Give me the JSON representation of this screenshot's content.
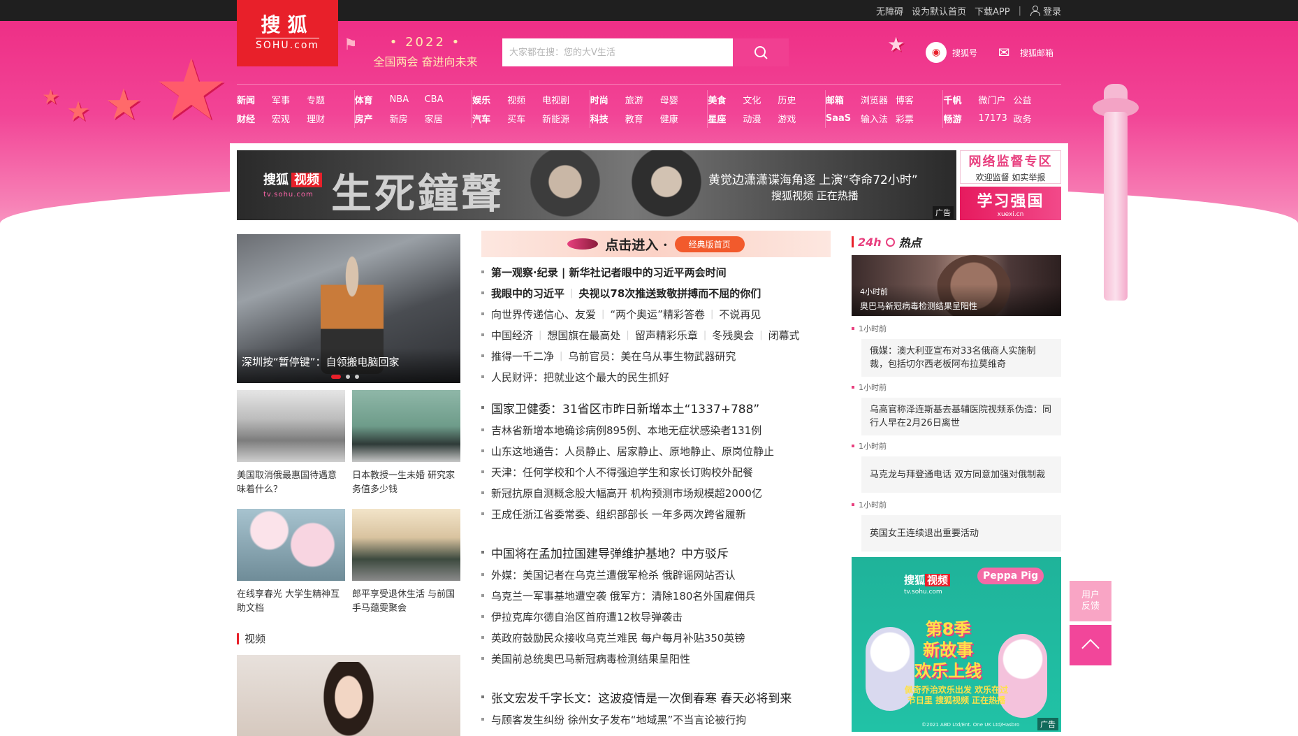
{
  "topbar": {
    "links": [
      "无障碍",
      "设为默认首页",
      "下载APP"
    ],
    "login": "登录"
  },
  "header": {
    "logo_cn": "搜狐",
    "logo_en": "SOHU.com",
    "slogan_year": "• 2022 •",
    "slogan_text": "全国两会   奋进向未来",
    "search_placeholder": "大家都在搜：您的大V生活",
    "quick": [
      "搜狐号",
      "搜狐邮箱"
    ]
  },
  "nav": [
    [
      [
        "新闻",
        "军事",
        "专题"
      ],
      [
        "财经",
        "宏观",
        "理财"
      ]
    ],
    [
      [
        "体育",
        "NBA",
        "CBA"
      ],
      [
        "房产",
        "新房",
        "家居"
      ]
    ],
    [
      [
        "娱乐",
        "视频",
        "电视剧"
      ],
      [
        "汽车",
        "买车",
        "新能源"
      ]
    ],
    [
      [
        "时尚",
        "旅游",
        "母婴"
      ],
      [
        "科技",
        "教育",
        "健康"
      ]
    ],
    [
      [
        "美食",
        "文化",
        "历史"
      ],
      [
        "星座",
        "动漫",
        "游戏"
      ]
    ],
    [
      [
        "邮箱",
        "浏览器",
        "博客"
      ],
      [
        "SaaS",
        "输入法",
        "彩票"
      ]
    ],
    [
      [
        "千帆",
        "微门户",
        "公益"
      ],
      [
        "畅游",
        "17173",
        "政务"
      ]
    ]
  ],
  "banner": {
    "brand": "搜狐",
    "brand_tv": "视频",
    "brand_url": "tv.sohu.com",
    "title": "生死鐘聲",
    "tag1": "黄觉边潇潇谍海角逐  上演“夺命72小时”",
    "tag2": "搜狐视频  正在热播",
    "ad": "广告",
    "side1_t1": "网络监督专区",
    "side1_t2": "欢迎监督  如实举报",
    "side2_t1": "学习强国",
    "side2_t2": "xuexi.cn"
  },
  "left": {
    "carousel_title": "深圳按“暂停键”：自领搬电脑回家",
    "thumbs": [
      "美国取消俄最惠国待遇意味着什么？",
      "日本教授一生未婚 研究家务值多少钱",
      "在线享春光 大学生精神互助文档",
      "郎平享受退休生活 与前国手马蕴雯聚会"
    ],
    "video_section": "视频"
  },
  "middle": {
    "enter_text": "点击进入 ·",
    "enter_pill": "经典版首页",
    "group1": [
      {
        "bold": true,
        "items": [
          "第一观察·纪录 | 新华社记者眼中的习近平两会时间"
        ]
      },
      {
        "bold": true,
        "items": [
          "我眼中的习近平",
          "央视以78次推送致敬拼搏而不屈的你们"
        ]
      },
      {
        "bold": false,
        "items": [
          "向世界传递信心、友爱",
          "“两个奥运”精彩答卷",
          "不说再见"
        ]
      },
      {
        "bold": false,
        "items": [
          "中国经济",
          "想国旗在最高处",
          "留声精彩乐章",
          "冬残奥会",
          "闭幕式"
        ]
      },
      {
        "bold": false,
        "items": [
          "推得一千二净",
          "乌前官员：美在乌从事生物武器研究"
        ]
      },
      {
        "bold": false,
        "items": [
          "人民财评：把就业这个最大的民生抓好"
        ]
      }
    ],
    "group2": [
      {
        "lead": true,
        "items": [
          "国家卫健委：31省区市昨日新增本土“1337+788”"
        ]
      },
      {
        "lead": false,
        "items": [
          "吉林省新增本地确诊病例895例、本地无症状感染者131例"
        ]
      },
      {
        "lead": false,
        "items": [
          "山东这地通告：人员静止、居家静止、原地静止、原岗位静止"
        ]
      },
      {
        "lead": false,
        "items": [
          "天津：任何学校和个人不得强迫学生和家长订购校外配餐"
        ]
      },
      {
        "lead": false,
        "items": [
          "新冠抗原自测概念股大幅高开 机构预测市场规模超2000亿"
        ]
      },
      {
        "lead": false,
        "items": [
          "王成任浙江省委常委、组织部部长 一年多两次跨省履新"
        ]
      }
    ],
    "group3": [
      {
        "lead": true,
        "items": [
          "中国将在孟加拉国建导弹维护基地？中方驳斥"
        ]
      },
      {
        "lead": false,
        "items": [
          "外媒：美国记者在乌克兰遭俄军枪杀 俄辟谣网站否认"
        ]
      },
      {
        "lead": false,
        "items": [
          "乌克兰一军事基地遭空袭 俄军方：清除180名外国雇佣兵"
        ]
      },
      {
        "lead": false,
        "items": [
          "伊拉克库尔德自治区首府遭12枚导弹袭击"
        ]
      },
      {
        "lead": false,
        "items": [
          "英政府鼓励民众接收乌克兰难民 每户每月补贴350英镑"
        ]
      },
      {
        "lead": false,
        "items": [
          "美国前总统奥巴马新冠病毒检测结果呈阳性"
        ]
      }
    ],
    "group4": [
      {
        "lead": true,
        "items": [
          "张文宏发千字长文：这波疫情是一次倒春寒 春天必将到来"
        ]
      },
      {
        "lead": false,
        "items": [
          "与顾客发生纠纷 徐州女子发布“地域黑”不当言论被行拘"
        ]
      }
    ]
  },
  "right": {
    "hot_title_a": "24h",
    "hot_title_b": "热点",
    "hot_img_time": "4小时前",
    "hot_img_title": "奥巴马新冠病毒检测结果呈阳性",
    "items": [
      {
        "time": "1小时前",
        "title": "俄媒：澳大利亚宣布对33名俄商人实施制裁，包括切尔西老板阿布拉莫维奇"
      },
      {
        "time": "1小时前",
        "title": "乌高官称泽连斯基去基辅医院视频系伪造：同行人早在2月26日离世"
      },
      {
        "time": "1小时前",
        "title": "马克龙与拜登通电话 双方同意加强对俄制裁"
      },
      {
        "time": "1小时前",
        "title": "英国女王连续退出重要活动"
      }
    ],
    "ad": {
      "brand": "搜狐",
      "brand_tv": "视频",
      "brand_url": "tv.sohu.com",
      "peppa": "Peppa Pig",
      "big1": "第8季",
      "big2": "新故事",
      "big3": "欢乐上线",
      "bottom": "佩奇乔治欢乐出发 欢乐在过节日里 搜狐视频 正在热播",
      "copy": "©2021 ABD Ltd/Ent. One UK Ltd/Hasbro",
      "label": "广告"
    }
  },
  "float": {
    "feedback": "用户反馈"
  }
}
